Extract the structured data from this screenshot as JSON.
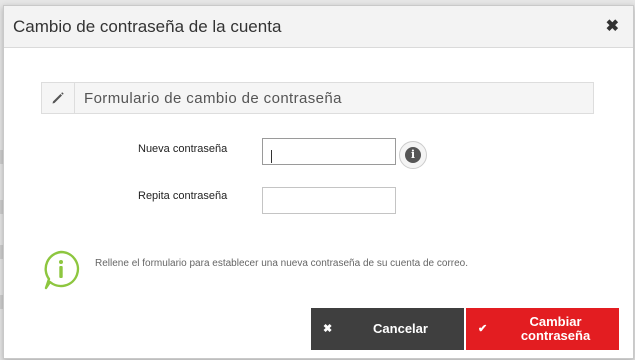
{
  "dialog": {
    "title": "Cambio de contraseña de la cuenta",
    "close_icon": "close-icon"
  },
  "form": {
    "banner_icon": "pencil-icon",
    "banner_title": "Formulario de cambio de contraseña",
    "new_password": {
      "label": "Nueva contraseña",
      "value": "",
      "info_icon": "info-icon"
    },
    "repeat_password": {
      "label": "Repita contraseña",
      "value": ""
    },
    "help_icon": "info-bubble-icon",
    "help_text": "Rellene el formulario para establecer una nueva contraseña de su cuenta de correo."
  },
  "actions": {
    "cancel_label": "Cancelar",
    "cancel_icon": "close-icon",
    "submit_label": "Cambiar contraseña",
    "submit_icon": "check-icon"
  },
  "colors": {
    "accent": "#e31d21",
    "dark_button": "#3f3f3f",
    "help_icon": "#8dc63f"
  }
}
